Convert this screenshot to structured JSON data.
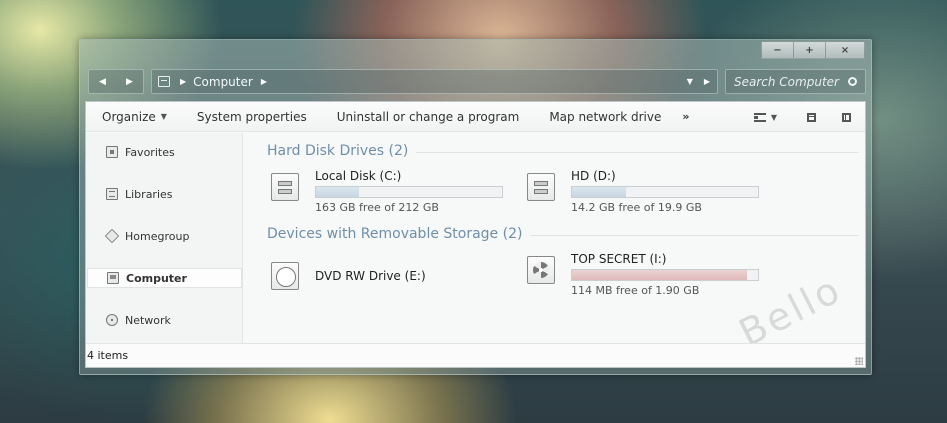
{
  "window": {
    "caption": {
      "minimize": "−",
      "maximize": "+",
      "close": "×"
    }
  },
  "navbar": {
    "back": "◀",
    "forward": "▶",
    "address": {
      "icon": "computer-icon",
      "path": "Computer",
      "separator": "▶",
      "dropdown": "▼",
      "go": "▶"
    },
    "search": {
      "placeholder": "Search Computer",
      "icon": "search-icon"
    }
  },
  "toolbar": {
    "organize": "Organize",
    "items": [
      "System properties",
      "Uninstall or change a program",
      "Map network drive"
    ],
    "more": "»",
    "view_arrow": "▼"
  },
  "sidebar": {
    "items": [
      {
        "label": "Favorites",
        "icon": "star-icon",
        "selected": false
      },
      {
        "label": "Libraries",
        "icon": "library-icon",
        "selected": false
      },
      {
        "label": "Homegroup",
        "icon": "homegroup-icon",
        "selected": false
      },
      {
        "label": "Computer",
        "icon": "computer-icon",
        "selected": true
      },
      {
        "label": "Network",
        "icon": "network-icon",
        "selected": false
      }
    ]
  },
  "groups": [
    {
      "title": "Hard Disk Drives (2)",
      "drives": [
        {
          "name": "Local Disk (C:)",
          "free": "163 GB free of 212 GB",
          "used_fraction": 0.23,
          "icon": "hard-drive-icon"
        },
        {
          "name": "HD (D:)",
          "free": "14.2 GB free of 19.9 GB",
          "used_fraction": 0.29,
          "icon": "hard-drive-icon"
        }
      ]
    },
    {
      "title": "Devices with Removable Storage (2)",
      "drives": [
        {
          "name": "DVD RW Drive (E:)",
          "icon": "dvd-drive-icon"
        },
        {
          "name": "TOP SECRET (I:)",
          "free": "114 MB free of 1.90 GB",
          "used_fraction": 0.94,
          "icon": "radiation-drive-icon",
          "bar_color": "#dfb9b9"
        }
      ]
    }
  ],
  "watermark": "Bello",
  "status": {
    "items": "4 items"
  },
  "colors": {
    "group_header": "#6f8fa9",
    "bar_fill": "#c8d6e2",
    "bar_fill_full": "#dfb9b9"
  }
}
